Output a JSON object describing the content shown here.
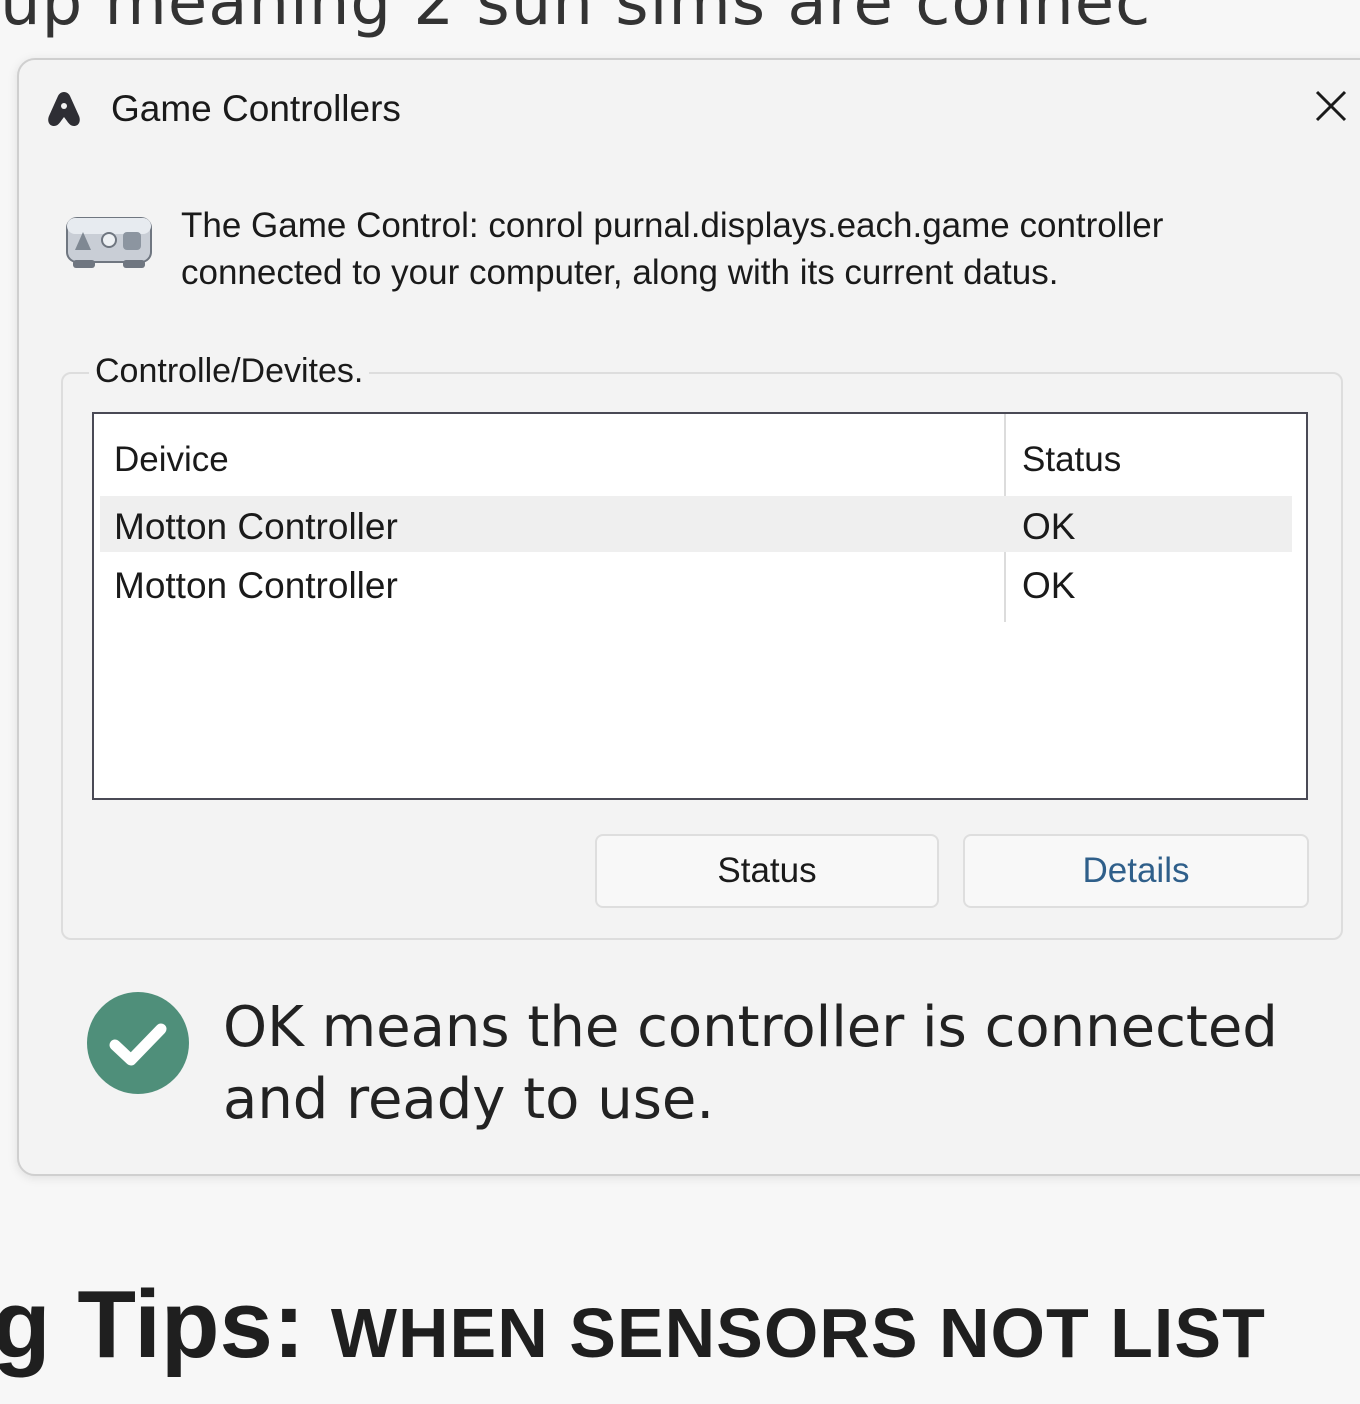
{
  "background": {
    "top_text": "up meaning 2 sun sims are connec",
    "bottom_tips": "g Tips:",
    "bottom_caps": "WHEN SENSORS NOT LIST"
  },
  "dialog": {
    "title": "Game Controllers",
    "title_icon": "game-controller-icon",
    "close_icon": "close-icon",
    "intro_icon": "controllers-device-icon",
    "intro_text": "The Game Control: conrol purnal.displays.each.game controller connected to your computer, along with its current datus.",
    "group_label": "Controlle/Devites.",
    "table": {
      "columns": [
        "Deivice",
        "Status"
      ],
      "rows": [
        {
          "device": "Motton Controller",
          "status": "OK",
          "selected": true
        },
        {
          "device": "Motton Controller",
          "status": "OK",
          "selected": false
        }
      ]
    },
    "buttons": {
      "status_label": "Status",
      "details_label": "Details"
    },
    "note": {
      "icon": "checkmark-circle-icon",
      "text": "OK means the controller is connected and ready to use."
    },
    "colors": {
      "accent_check": "#4f8f7a",
      "details_text": "#2f5f8a",
      "window_bg": "#f3f3f3"
    }
  }
}
